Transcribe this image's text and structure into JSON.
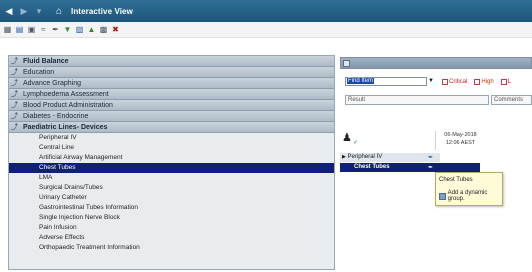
{
  "header": {
    "title": "Interactive View",
    "back_icon": "chevron-left",
    "forward_icon": "chevron-right",
    "history_icon": "chevron-down",
    "home_icon": "house"
  },
  "toolbar": {
    "icons": [
      "grid-icon",
      "table-icon",
      "document-icon",
      "wave-icon",
      "pencil-icon",
      "filter-icon",
      "delete-icon",
      "chart-icon",
      "form-icon",
      "close-icon"
    ]
  },
  "left_panel": {
    "sections": [
      {
        "label": "Fluid Balance",
        "bold": true
      },
      {
        "label": "Education"
      },
      {
        "label": "Advance Graphing"
      },
      {
        "label": "Lymphoedema Assessment"
      },
      {
        "label": "Blood Product Administration"
      },
      {
        "label": "Diabetes - Endocrine"
      },
      {
        "label": "Paediatric Lines- Devices",
        "bold": true
      }
    ],
    "sub_items": [
      "Peripheral IV",
      "Central Line",
      "Artificial Airway Management",
      "Chest Tubes",
      "LMA",
      "Surgical Drains/Tubes",
      "Urinary Catheter",
      "Gastrointestinal Tubes Information",
      "Single Injection Nerve Block",
      "Pain Infusion",
      "Adverse Effects",
      "Orthopaedic Treatment Information"
    ],
    "selected_item": "Chest Tubes"
  },
  "right_panel": {
    "filter": {
      "selected": "Find Item"
    },
    "checkboxes": {
      "critical": "Critical",
      "high": "High",
      "last": "L"
    },
    "columns": {
      "result": "Result",
      "comments": "Comments"
    },
    "date": "06-May-2018",
    "time": "12:06 AEST",
    "rows": {
      "peripheral": "Peripheral IV",
      "chest": "Chest Tubes"
    },
    "tooltip": {
      "title": "Chest Tubes",
      "action": "Add a dynamic group."
    }
  }
}
